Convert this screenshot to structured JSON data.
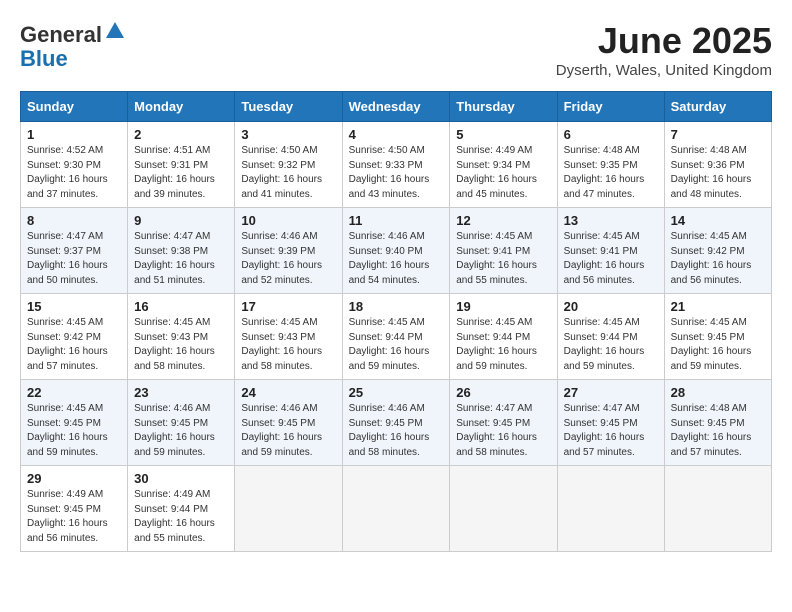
{
  "logo": {
    "general": "General",
    "blue": "Blue"
  },
  "title": "June 2025",
  "location": "Dyserth, Wales, United Kingdom",
  "days_of_week": [
    "Sunday",
    "Monday",
    "Tuesday",
    "Wednesday",
    "Thursday",
    "Friday",
    "Saturday"
  ],
  "weeks": [
    [
      {
        "day": "1",
        "info": "Sunrise: 4:52 AM\nSunset: 9:30 PM\nDaylight: 16 hours\nand 37 minutes."
      },
      {
        "day": "2",
        "info": "Sunrise: 4:51 AM\nSunset: 9:31 PM\nDaylight: 16 hours\nand 39 minutes."
      },
      {
        "day": "3",
        "info": "Sunrise: 4:50 AM\nSunset: 9:32 PM\nDaylight: 16 hours\nand 41 minutes."
      },
      {
        "day": "4",
        "info": "Sunrise: 4:50 AM\nSunset: 9:33 PM\nDaylight: 16 hours\nand 43 minutes."
      },
      {
        "day": "5",
        "info": "Sunrise: 4:49 AM\nSunset: 9:34 PM\nDaylight: 16 hours\nand 45 minutes."
      },
      {
        "day": "6",
        "info": "Sunrise: 4:48 AM\nSunset: 9:35 PM\nDaylight: 16 hours\nand 47 minutes."
      },
      {
        "day": "7",
        "info": "Sunrise: 4:48 AM\nSunset: 9:36 PM\nDaylight: 16 hours\nand 48 minutes."
      }
    ],
    [
      {
        "day": "8",
        "info": "Sunrise: 4:47 AM\nSunset: 9:37 PM\nDaylight: 16 hours\nand 50 minutes."
      },
      {
        "day": "9",
        "info": "Sunrise: 4:47 AM\nSunset: 9:38 PM\nDaylight: 16 hours\nand 51 minutes."
      },
      {
        "day": "10",
        "info": "Sunrise: 4:46 AM\nSunset: 9:39 PM\nDaylight: 16 hours\nand 52 minutes."
      },
      {
        "day": "11",
        "info": "Sunrise: 4:46 AM\nSunset: 9:40 PM\nDaylight: 16 hours\nand 54 minutes."
      },
      {
        "day": "12",
        "info": "Sunrise: 4:45 AM\nSunset: 9:41 PM\nDaylight: 16 hours\nand 55 minutes."
      },
      {
        "day": "13",
        "info": "Sunrise: 4:45 AM\nSunset: 9:41 PM\nDaylight: 16 hours\nand 56 minutes."
      },
      {
        "day": "14",
        "info": "Sunrise: 4:45 AM\nSunset: 9:42 PM\nDaylight: 16 hours\nand 56 minutes."
      }
    ],
    [
      {
        "day": "15",
        "info": "Sunrise: 4:45 AM\nSunset: 9:42 PM\nDaylight: 16 hours\nand 57 minutes."
      },
      {
        "day": "16",
        "info": "Sunrise: 4:45 AM\nSunset: 9:43 PM\nDaylight: 16 hours\nand 58 minutes."
      },
      {
        "day": "17",
        "info": "Sunrise: 4:45 AM\nSunset: 9:43 PM\nDaylight: 16 hours\nand 58 minutes."
      },
      {
        "day": "18",
        "info": "Sunrise: 4:45 AM\nSunset: 9:44 PM\nDaylight: 16 hours\nand 59 minutes."
      },
      {
        "day": "19",
        "info": "Sunrise: 4:45 AM\nSunset: 9:44 PM\nDaylight: 16 hours\nand 59 minutes."
      },
      {
        "day": "20",
        "info": "Sunrise: 4:45 AM\nSunset: 9:44 PM\nDaylight: 16 hours\nand 59 minutes."
      },
      {
        "day": "21",
        "info": "Sunrise: 4:45 AM\nSunset: 9:45 PM\nDaylight: 16 hours\nand 59 minutes."
      }
    ],
    [
      {
        "day": "22",
        "info": "Sunrise: 4:45 AM\nSunset: 9:45 PM\nDaylight: 16 hours\nand 59 minutes."
      },
      {
        "day": "23",
        "info": "Sunrise: 4:46 AM\nSunset: 9:45 PM\nDaylight: 16 hours\nand 59 minutes."
      },
      {
        "day": "24",
        "info": "Sunrise: 4:46 AM\nSunset: 9:45 PM\nDaylight: 16 hours\nand 59 minutes."
      },
      {
        "day": "25",
        "info": "Sunrise: 4:46 AM\nSunset: 9:45 PM\nDaylight: 16 hours\nand 58 minutes."
      },
      {
        "day": "26",
        "info": "Sunrise: 4:47 AM\nSunset: 9:45 PM\nDaylight: 16 hours\nand 58 minutes."
      },
      {
        "day": "27",
        "info": "Sunrise: 4:47 AM\nSunset: 9:45 PM\nDaylight: 16 hours\nand 57 minutes."
      },
      {
        "day": "28",
        "info": "Sunrise: 4:48 AM\nSunset: 9:45 PM\nDaylight: 16 hours\nand 57 minutes."
      }
    ],
    [
      {
        "day": "29",
        "info": "Sunrise: 4:49 AM\nSunset: 9:45 PM\nDaylight: 16 hours\nand 56 minutes."
      },
      {
        "day": "30",
        "info": "Sunrise: 4:49 AM\nSunset: 9:44 PM\nDaylight: 16 hours\nand 55 minutes."
      },
      {
        "day": "",
        "info": ""
      },
      {
        "day": "",
        "info": ""
      },
      {
        "day": "",
        "info": ""
      },
      {
        "day": "",
        "info": ""
      },
      {
        "day": "",
        "info": ""
      }
    ]
  ]
}
